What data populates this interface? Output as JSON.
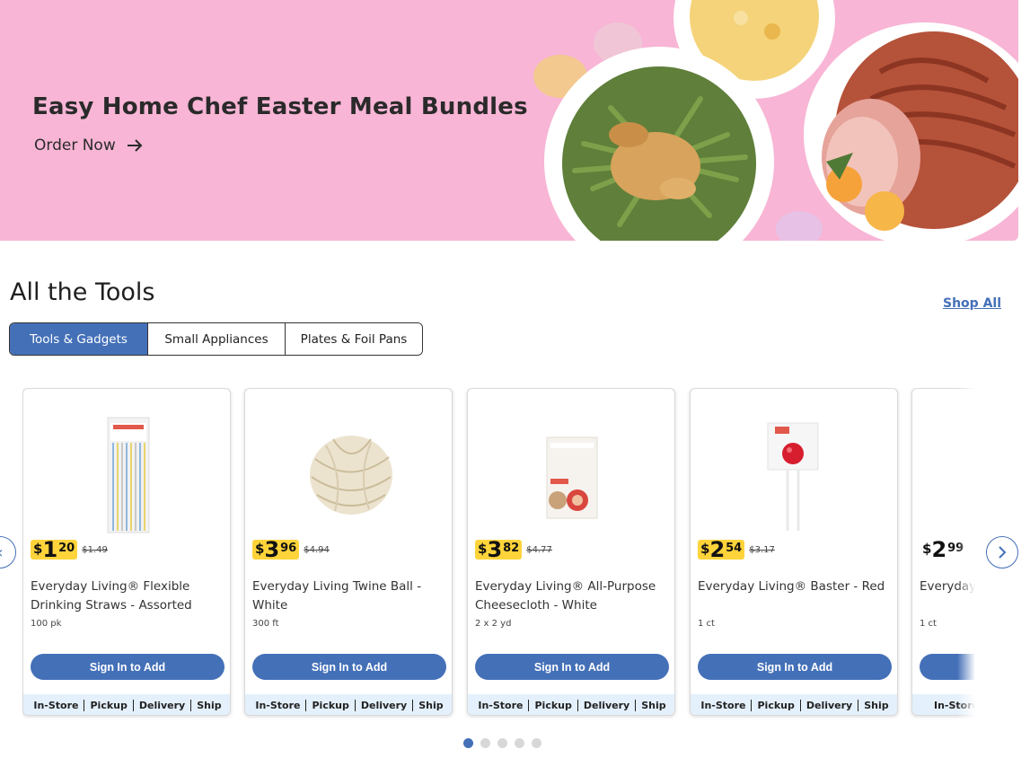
{
  "banner": {
    "title": "Easy Home Chef Easter Meal Bundles",
    "cta_label": "Order Now",
    "cta_icon": "arrow-right-icon",
    "background_color": "#f8b5d5"
  },
  "section": {
    "title": "All the Tools",
    "shop_all_label": "Shop All"
  },
  "tabs": [
    {
      "label": "Tools & Gadgets",
      "active": true
    },
    {
      "label": "Small Appliances",
      "active": false
    },
    {
      "label": "Plates & Foil Pans",
      "active": false
    }
  ],
  "products": [
    {
      "price_dollars": "1",
      "price_cents": "20",
      "was_price": "$1.49",
      "on_sale": true,
      "name": "Everyday Living® Flexible Drinking Straws - Assorted",
      "size": "100 pk",
      "button_label": "Sign In to Add",
      "fulfillment": [
        "In-Store",
        "Pickup",
        "Delivery",
        "Ship"
      ]
    },
    {
      "price_dollars": "3",
      "price_cents": "96",
      "was_price": "$4.94",
      "on_sale": true,
      "name": "Everyday Living Twine Ball - White",
      "size": "300 ft",
      "button_label": "Sign In to Add",
      "fulfillment": [
        "In-Store",
        "Pickup",
        "Delivery",
        "Ship"
      ]
    },
    {
      "price_dollars": "3",
      "price_cents": "82",
      "was_price": "$4.77",
      "on_sale": true,
      "name": "Everyday Living® All-Purpose Cheesecloth - White",
      "size": "2 x 2 yd",
      "button_label": "Sign In to Add",
      "fulfillment": [
        "In-Store",
        "Pickup",
        "Delivery",
        "Ship"
      ]
    },
    {
      "price_dollars": "2",
      "price_cents": "54",
      "was_price": "$3.17",
      "on_sale": true,
      "name": "Everyday Living® Baster - Red",
      "size": "1 ct",
      "button_label": "Sign In to Add",
      "fulfillment": [
        "In-Store",
        "Pickup",
        "Delivery",
        "Ship"
      ]
    },
    {
      "price_dollars": "2",
      "price_cents": "99",
      "was_price": "",
      "on_sale": false,
      "name": "Everyday Living® Bottle - C",
      "size": "1 ct",
      "button_label": "",
      "fulfillment": [
        "In-Store"
      ]
    }
  ],
  "currency_symbol": "$",
  "carousel": {
    "prev_icon": "chevron-left-icon",
    "next_icon": "chevron-right-icon",
    "pages": 5,
    "current_page": 1
  },
  "colors": {
    "accent": "#4470b8",
    "sale_badge": "#ffd43b",
    "fulfillment_bg": "#e4f0fb"
  }
}
